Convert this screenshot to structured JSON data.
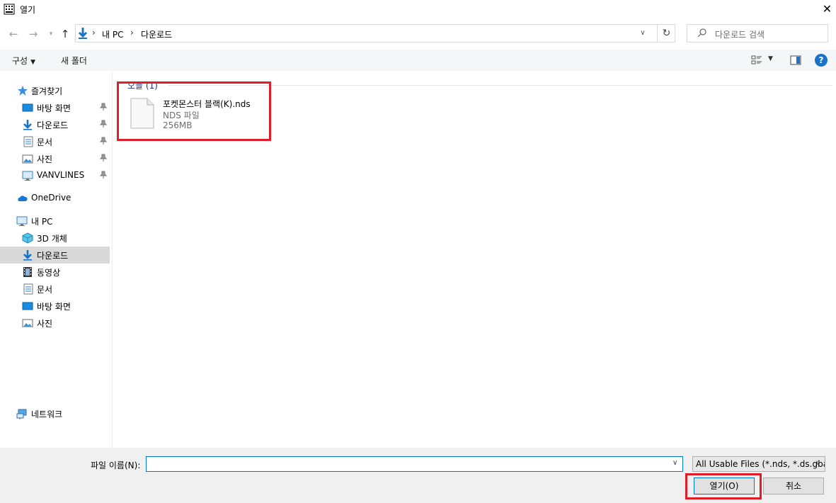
{
  "window": {
    "title": "열기"
  },
  "address": {
    "crumbs": [
      "내 PC",
      "다운로드"
    ],
    "search_placeholder": "다운로드 검색"
  },
  "toolbar": {
    "organize_label": "구성",
    "new_folder_label": "새 폴더"
  },
  "sidebar": {
    "quick_access": "즐겨찾기",
    "quick_items": [
      "바탕 화면",
      "다운로드",
      "문서",
      "사진",
      "VANVLINES"
    ],
    "onedrive": "OneDrive",
    "this_pc": "내 PC",
    "pc_items": [
      "3D 개체",
      "다운로드",
      "동영상",
      "문서",
      "바탕 화면",
      "사진"
    ],
    "network": "네트워크"
  },
  "content": {
    "group_header": "오늘 (1)",
    "file": {
      "name": "포켓몬스터 블랙(K).nds",
      "type": "NDS 파일",
      "size": "256MB"
    }
  },
  "bottom": {
    "filename_label": "파일 이름(N):",
    "filename_value": "",
    "filter_label": "All Usable Files (*.nds, *.ds.gba",
    "open_label": "열기(O)",
    "cancel_label": "취소"
  },
  "colors": {
    "accent": "#0078d7",
    "highlight": "#e11d2a",
    "selection": "#d9d9d9"
  }
}
